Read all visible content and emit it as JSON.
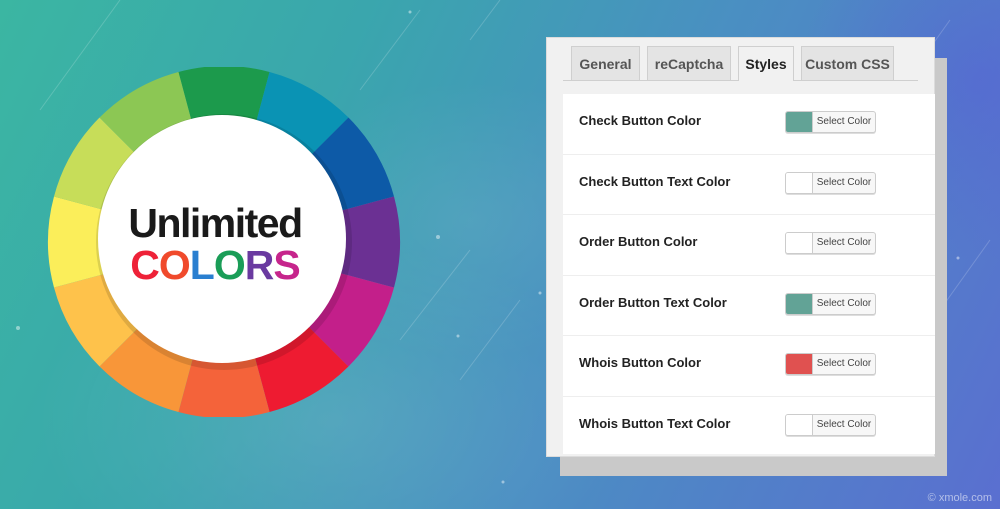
{
  "logo": {
    "line1": "Unlimited",
    "line2_letters": [
      {
        "char": "C",
        "color": "#ee2238"
      },
      {
        "char": "O",
        "color": "#f04a2c"
      },
      {
        "char": "L",
        "color": "#2a7fd0"
      },
      {
        "char": "O",
        "color": "#1a9d57"
      },
      {
        "char": "R",
        "color": "#6a3aa0"
      },
      {
        "char": "S",
        "color": "#c6258c"
      }
    ]
  },
  "wheel_colors": [
    "#1c9a4c",
    "#0a93b4",
    "#0d5aa7",
    "#6b3093",
    "#c31f8a",
    "#ee1b31",
    "#f4633a",
    "#f89639",
    "#fec24b",
    "#fbee5a",
    "#c7dd59",
    "#8cc754"
  ],
  "settings": {
    "tabs": [
      {
        "label": "General",
        "active": false
      },
      {
        "label": "reCaptcha",
        "active": false
      },
      {
        "label": "Styles",
        "active": true
      },
      {
        "label": "Custom CSS",
        "active": false
      }
    ],
    "rows": [
      {
        "label": "Check Button Color",
        "button": "Select Color",
        "swatch": "#62a396"
      },
      {
        "label": "Check Button Text Color",
        "button": "Select Color",
        "swatch": "#ffffff"
      },
      {
        "label": "Order Button Color",
        "button": "Select Color",
        "swatch": "#ffffff"
      },
      {
        "label": "Order Button Text Color",
        "button": "Select Color",
        "swatch": "#62a396"
      },
      {
        "label": "Whois Button Color",
        "button": "Select Color",
        "swatch": "#e05150"
      },
      {
        "label": "Whois Button Text Color",
        "button": "Select Color",
        "swatch": "#ffffff"
      }
    ]
  },
  "watermark": "© xmole.com"
}
